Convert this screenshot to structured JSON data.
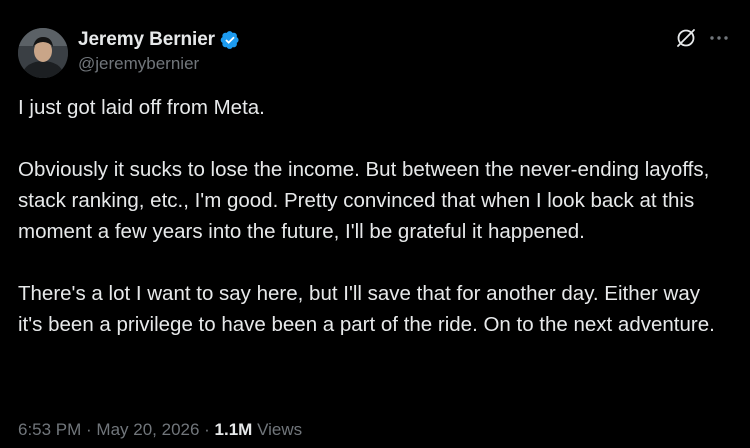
{
  "author": {
    "display_name": "Jeremy Bernier",
    "handle": "@jeremybernier",
    "verified": true
  },
  "tweet": {
    "paragraphs": [
      "I just got laid off from Meta.",
      "Obviously it sucks to lose the income. But between the never-ending layoffs, stack ranking, etc., I'm good. Pretty convinced that when I look back at this moment a few years into the future, I'll be grateful it happened.",
      "There's a lot I want to say here, but I'll save that for another day. Either way it's been a privilege to have been a part of the ride. On to the next adventure."
    ]
  },
  "meta": {
    "time": "6:53 PM",
    "separator": " · ",
    "date": "May 20, 2026",
    "views_count": "1.1M",
    "views_label": " Views"
  },
  "icons": {
    "verified": "verified-badge-icon",
    "grok": "grok-icon",
    "more": "more-icon"
  },
  "colors": {
    "background": "#000000",
    "text": "#e7e9ea",
    "secondary": "#71767b",
    "verified": "#1d9bf0"
  }
}
